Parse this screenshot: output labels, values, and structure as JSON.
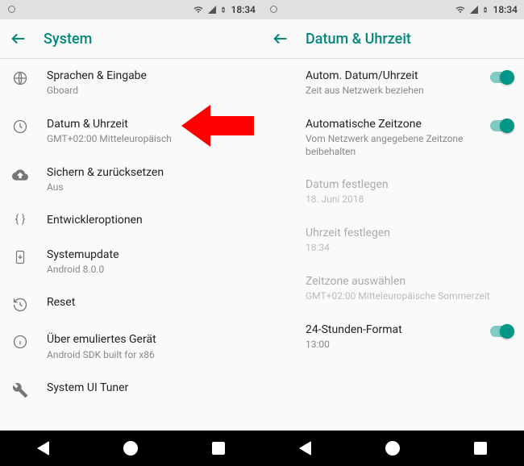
{
  "statusbar": {
    "time": "18:34"
  },
  "left": {
    "title": "System",
    "items": [
      {
        "primary": "Sprachen & Eingabe",
        "secondary": "Gboard"
      },
      {
        "primary": "Datum & Uhrzeit",
        "secondary": "GMT+02:00 Mitteleuropäisch"
      },
      {
        "primary": "Sichern & zurücksetzen",
        "secondary": "Aus"
      },
      {
        "primary": "Entwickleroptionen",
        "secondary": ""
      },
      {
        "primary": "Systemupdate",
        "secondary": "Android 8.0.0"
      },
      {
        "primary": "Reset",
        "secondary": ""
      },
      {
        "primary": "Über emuliertes Gerät",
        "secondary": "Android SDK built for x86"
      },
      {
        "primary": "System UI Tuner",
        "secondary": ""
      }
    ]
  },
  "right": {
    "title": "Datum & Uhrzeit",
    "items": [
      {
        "primary": "Autom. Datum/Uhrzeit",
        "secondary": "Zeit aus Netzwerk beziehen",
        "toggle": true,
        "disabled": false
      },
      {
        "primary": "Automatische Zeitzone",
        "secondary": "Vom Netzwerk angegebene Zeitzone beibehalten",
        "toggle": true,
        "disabled": false
      },
      {
        "primary": "Datum festlegen",
        "secondary": "18. Juni 2018",
        "toggle": false,
        "disabled": true
      },
      {
        "primary": "Uhrzeit festlegen",
        "secondary": "18:34",
        "toggle": false,
        "disabled": true
      },
      {
        "primary": "Zeitzone auswählen",
        "secondary": "GMT+02:00 Mitteleuropäische Sommerzeit",
        "toggle": false,
        "disabled": true
      },
      {
        "primary": "24-Stunden-Format",
        "secondary": "13:00",
        "toggle": true,
        "disabled": false
      }
    ]
  }
}
